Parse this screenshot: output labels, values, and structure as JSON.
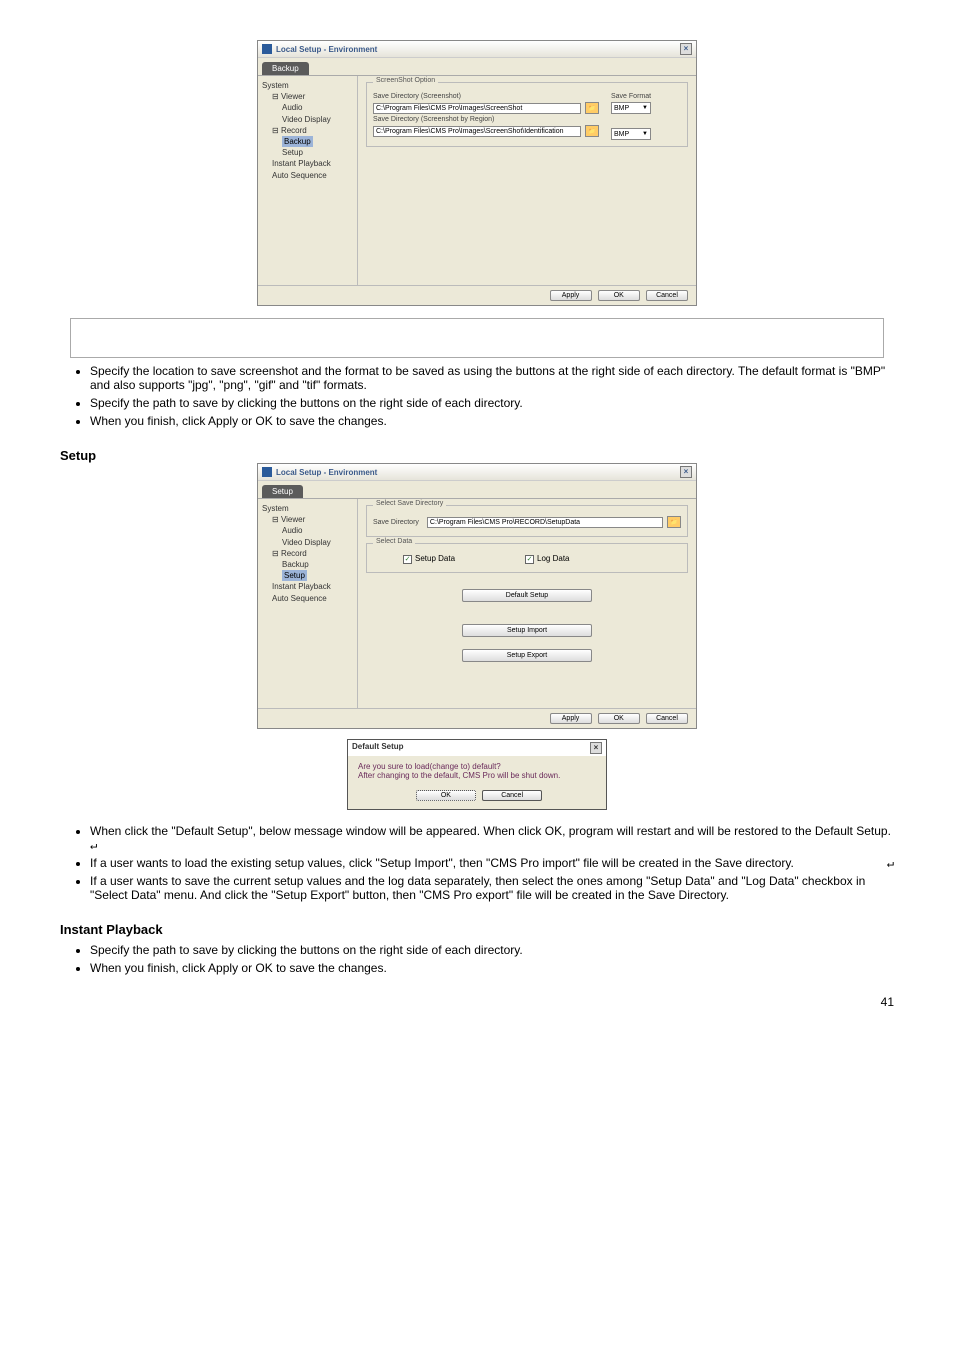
{
  "dialog1": {
    "title": "Local Setup - Environment",
    "tab": "Backup",
    "tree": [
      "System",
      "Viewer",
      "Audio",
      "Video Display",
      "Record",
      "Backup",
      "Setup",
      "Instant Playback",
      "Auto Sequence"
    ],
    "group": "ScreenShot Option",
    "lbl_dir1": "Save Directory (Screenshot)",
    "path1": "C:\\Program Files\\CMS Pro\\Images\\ScreenShot",
    "lbl_dir2": "Save Directory (Screenshot by Region)",
    "path2": "C:\\Program Files\\CMS Pro\\Images\\ScreenShot\\Identification",
    "save_format": "Save Format",
    "fmt": "BMP",
    "apply": "Apply",
    "ok": "OK",
    "cancel": "Cancel"
  },
  "section1": {
    "bullets": [
      "Specify the location to save screenshot and the format to be saved as using the buttons at the right side of each directory. The default format is \"BMP\" and also supports \"jpg\", \"png\", \"gif\" and \"tif\" formats.",
      "Specify the path to save by clicking the buttons on the right side of each directory.",
      "When you finish, click Apply or OK to save the changes."
    ],
    "heading": "Setup"
  },
  "dialog2": {
    "title": "Local Setup - Environment",
    "tab": "Setup",
    "tree": [
      "System",
      "Viewer",
      "Audio",
      "Video Display",
      "Record",
      "Backup",
      "Setup",
      "Instant Playback",
      "Auto Sequence"
    ],
    "grp1": "Select Save Directory",
    "lbl_dir": "Save Directory",
    "path": "C:\\Program Files\\CMS Pro\\RECORD\\SetupData",
    "grp2": "Select Data",
    "chk1": "Setup Data",
    "chk2": "Log Data",
    "btn_default": "Default Setup",
    "btn_import": "Setup Import",
    "btn_export": "Setup Export",
    "apply": "Apply",
    "ok": "OK",
    "cancel": "Cancel"
  },
  "msg": {
    "title": "Default Setup",
    "line1": "Are you sure to load(change to) default?",
    "line2": "After changing to the default, CMS Pro will be shut down.",
    "ok": "OK",
    "cancel": "Cancel"
  },
  "section2": {
    "bullets": [
      "When click the \"Default Setup\", below message window will be appeared. When click OK, program will restart and will be restored to the Default Setup.",
      "If a user wants to load the existing setup values, click \"Setup Import\", then \"CMS Pro import\" file will be created in the Save directory.",
      "If a user wants to save the current setup values and the log data separately, then select the ones among \"Setup Data\" and \"Log Data\" checkbox in \"Select Data\" menu. And click the \"Setup Export\" button, then \"CMS Pro export\" file will be created in the Save Directory.",
      "Specify the path to save by clicking the buttons on the right side of each directory.",
      "When you finish, click Apply or OK to save the changes."
    ],
    "heading": "Instant Playback"
  },
  "page": "41"
}
